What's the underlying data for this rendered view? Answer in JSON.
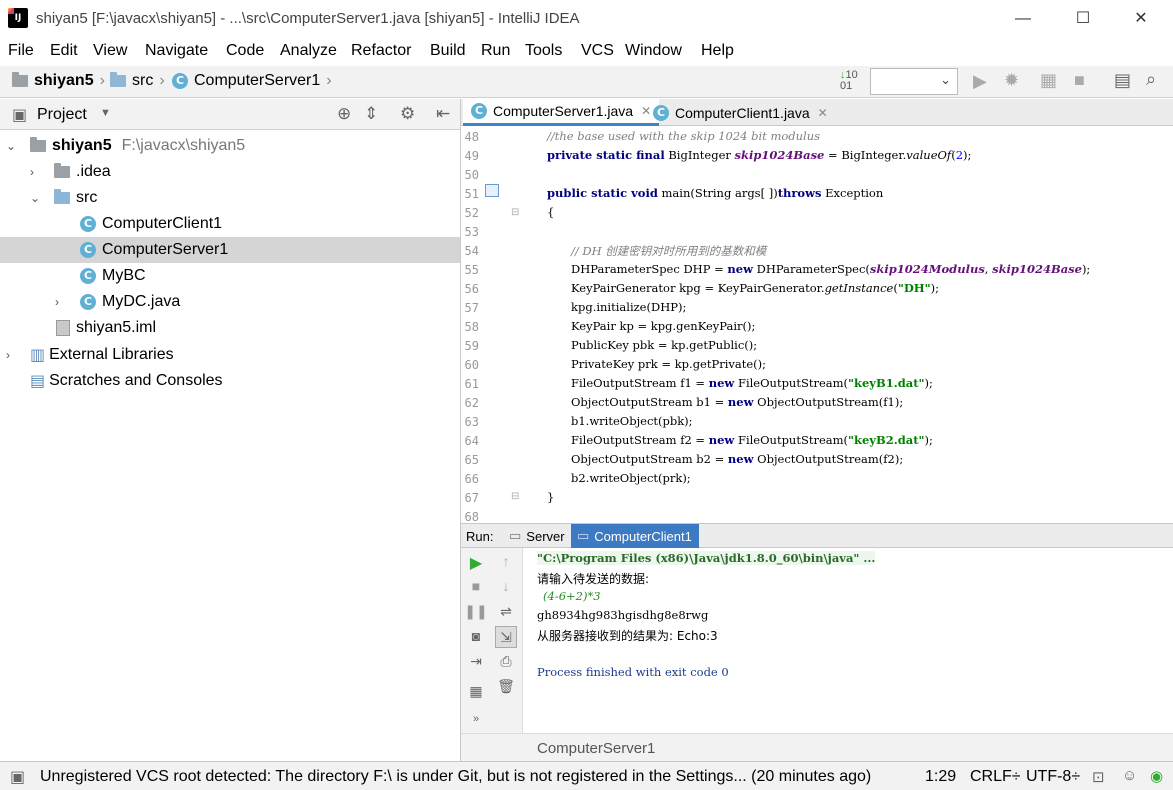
{
  "window": {
    "title": "shiyan5 [F:\\javacx\\shiyan5] - ...\\src\\ComputerServer1.java [shiyan5] - IntelliJ IDEA",
    "logo": "IJ"
  },
  "menu": [
    "File",
    "Edit",
    "View",
    "Navigate",
    "Code",
    "Analyze",
    "Refactor",
    "Build",
    "Run",
    "Tools",
    "VCS",
    "Window",
    "Help"
  ],
  "breadcrumb": {
    "project": "shiyan5",
    "folder": "src",
    "file": "ComputerServer1"
  },
  "project_panel": {
    "title": "Project",
    "tree": [
      {
        "label": "shiyan5",
        "path": "F:\\javacx\\shiyan5"
      },
      {
        "label": ".idea"
      },
      {
        "label": "src"
      },
      {
        "label": "ComputerClient1"
      },
      {
        "label": "ComputerServer1"
      },
      {
        "label": "MyBC"
      },
      {
        "label": "MyDC.java"
      },
      {
        "label": "shiyan5.iml"
      },
      {
        "label": "External Libraries"
      },
      {
        "label": "Scratches and Consoles"
      }
    ]
  },
  "editor": {
    "tabs": [
      "ComputerServer1.java",
      "ComputerClient1.java"
    ],
    "line_numbers": [
      "48",
      "49",
      "50",
      "51",
      "52",
      "53",
      "54",
      "55",
      "56",
      "57",
      "58",
      "59",
      "60",
      "61",
      "62",
      "63",
      "64",
      "65",
      "66",
      "67",
      "68"
    ]
  },
  "run": {
    "label": "Run:",
    "tabs": [
      "Server",
      "ComputerClient1"
    ],
    "console": [
      "\"C:\\Program Files (x86)\\Java\\jdk1.8.0_60\\bin\\java\" ...",
      "请输入待发送的数据:",
      "(4-6+2)*3",
      "gh8934hg983hgisdhg8e8rwg",
      "从服务器接收到的结果为: Echo:3",
      "",
      "Process finished with exit code 0"
    ],
    "footer_name": "ComputerServer1"
  },
  "status": {
    "message": "Unregistered VCS root detected: The directory F:\\ is under Git, but is not registered in the Settings... (20 minutes ago)",
    "position": "1:29",
    "line_sep": "CRLF÷",
    "encoding": "UTF-8÷"
  },
  "colors": {
    "keyword": "#000080",
    "comment": "#808080",
    "string": "#008000",
    "field": "#660e7a",
    "selection": "#d5d5d5",
    "run_tab_active": "#3d7ac4"
  }
}
